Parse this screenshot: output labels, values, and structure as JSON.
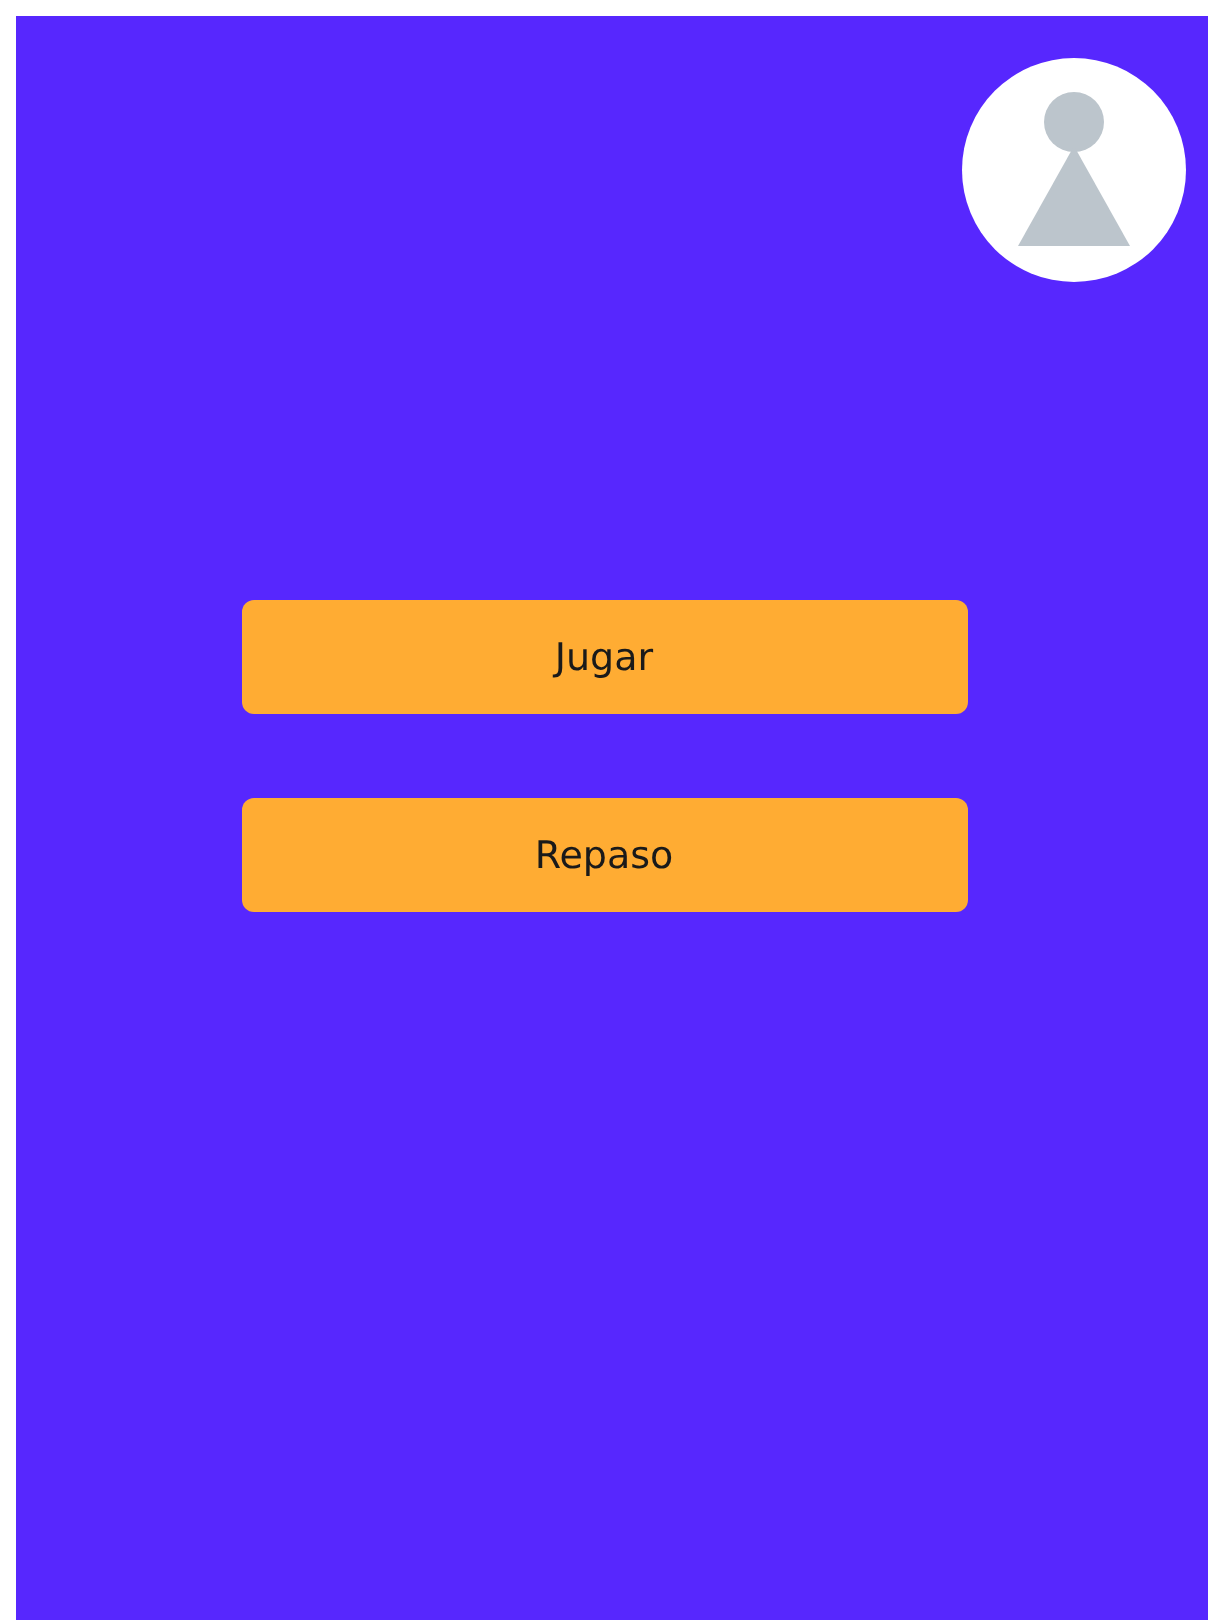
{
  "avatar": {
    "kind": "placeholder"
  },
  "buttons": [
    {
      "label": "Jugar"
    },
    {
      "label": "Repaso"
    }
  ]
}
